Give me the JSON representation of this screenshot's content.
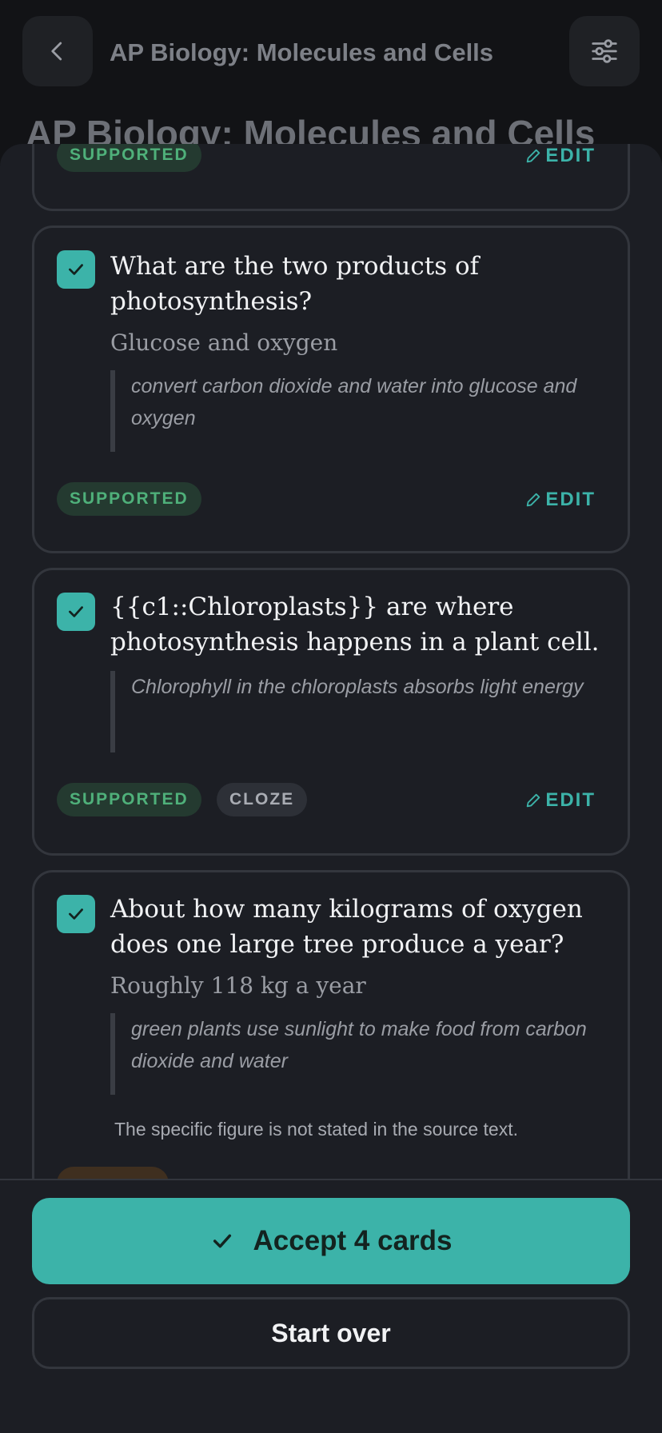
{
  "header": {
    "title": "AP Biology: Molecules and Cells",
    "page_title": "AP Biology: Molecules and Cells",
    "back_icon": "chevron-left-icon",
    "settings_icon": "sliders-icon"
  },
  "cards": [
    {
      "badges": [
        "SUPPORTED"
      ],
      "edit_label": "EDIT"
    },
    {
      "checked": true,
      "question": "What are the two products of photosynthesis?",
      "answer": "Glucose and oxygen",
      "quote": "convert carbon dioxide and water into glucose and oxygen",
      "badges": [
        "SUPPORTED"
      ],
      "edit_label": "EDIT"
    },
    {
      "checked": true,
      "question": "{{c1::Chloroplasts}} are where photosynthesis happens in a plant cell.",
      "quote": "Chlorophyll in the chloroplasts absorbs light energy",
      "badges": [
        "SUPPORTED",
        "CLOZE"
      ],
      "edit_label": "EDIT"
    },
    {
      "checked": true,
      "question": "About how many kilograms of oxygen does one large tree produce a year?",
      "answer": "Roughly 118 kg a year",
      "quote": "green plants use sunlight to make food from carbon dioxide and water",
      "note": "The specific figure is not stated in the source text."
    }
  ],
  "actions": {
    "accept_label": "Accept 4 cards",
    "start_over_label": "Start over"
  },
  "colors": {
    "accent": "#3cb3a9",
    "supported": "#4fb07a",
    "background": "#1c1e24"
  }
}
